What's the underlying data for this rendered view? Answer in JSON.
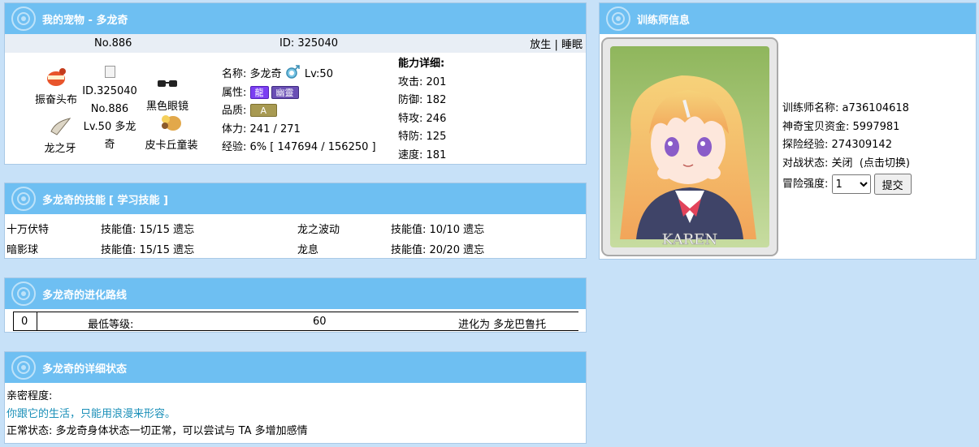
{
  "pet_panel": {
    "title": "我的宠物 - 多龙奇",
    "no": "No.886",
    "id": "ID: 325040",
    "action_release": "放生",
    "action_sep": "|",
    "action_sleep": "睡眠",
    "items": {
      "headband": "振奋头布",
      "dragon_fang": "龙之牙",
      "glasses": "黑色眼镜",
      "costume": "皮卡丘童装"
    },
    "sprite_alt": "ID.325040 No.886 Lv.50 多龙奇",
    "name_label": "名称:",
    "name_value": "多龙奇",
    "level": "Lv:50",
    "attr_label": "属性:",
    "attr_tags": [
      "龍",
      "幽靈"
    ],
    "quality_label": "品质:",
    "quality_value": "A",
    "hp_label": "体力:",
    "hp_value": "241 / 271",
    "exp_label": "经验:",
    "exp_value": "6% [ 147694 / 156250 ]",
    "ability_title": "能力详细:",
    "stats": [
      {
        "label": "攻击:",
        "value": "201"
      },
      {
        "label": "防御:",
        "value": "182"
      },
      {
        "label": "特攻:",
        "value": "246"
      },
      {
        "label": "特防:",
        "value": "125"
      },
      {
        "label": "速度:",
        "value": "181"
      }
    ]
  },
  "skills_panel": {
    "title": "多龙奇的技能",
    "learn_link": "[ 学习技能 ]",
    "skills": [
      {
        "name": "十万伏特",
        "pp": "技能值: 15/15",
        "forget": "遗忘"
      },
      {
        "name": "龙之波动",
        "pp": "技能值: 10/10",
        "forget": "遗忘"
      },
      {
        "name": "暗影球",
        "pp": "技能值: 15/15",
        "forget": "遗忘"
      },
      {
        "name": "龙息",
        "pp": "技能值: 20/20",
        "forget": "遗忘"
      }
    ]
  },
  "evolution_panel": {
    "title": "多龙奇的进化路线",
    "index": "0",
    "min_level_label": "最低等级:",
    "min_level": "60",
    "evolves_to": "进化为 多龙巴鲁托"
  },
  "status_panel": {
    "title": "多龙奇的详细状态",
    "intimacy_label": "亲密程度:",
    "intimacy_text": "你跟它的生活，只能用浪漫来形容。",
    "condition": "正常状态: 多龙奇身体状态一切正常，可以尝试与 TA 多增加感情"
  },
  "trainer_panel": {
    "title": "训练师信息",
    "card_caption": "KAREN",
    "name_label": "训练师名称:",
    "name_value": "a736104618",
    "funds_label": "神奇宝贝资金:",
    "funds_value": "5997981",
    "exp_label": "探险经验:",
    "exp_value": "274309142",
    "battle_label": "对战状态:",
    "battle_value": "关闭",
    "battle_hint": "(点击切换)",
    "risk_label": "冒险强度:",
    "risk_value": "1",
    "submit_label": "提交"
  },
  "colors": {
    "header": "#6ebff2",
    "background": "#c7e1f8",
    "link": "#1a6fb0",
    "romance_text": "#1a8fb8",
    "attr_dragon": "#7b3ff2",
    "attr_ghost": "#6a4fb5",
    "quality": "#a89a52"
  }
}
